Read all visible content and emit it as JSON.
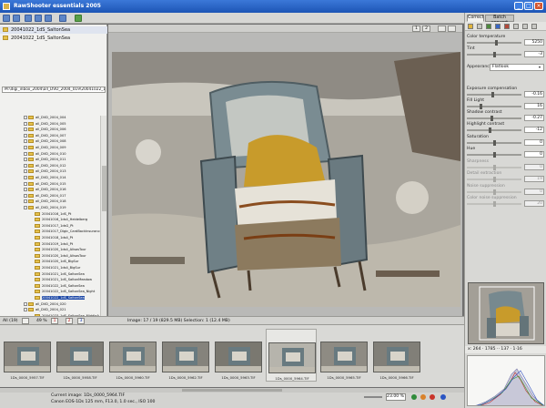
{
  "window": {
    "title": "RawShooter essentials 2005",
    "controls": {
      "minimize": "_",
      "maximize": "□",
      "close": "×"
    }
  },
  "left_panel": {
    "folders": [
      {
        "label": "20041022_1dS_SaltonSea",
        "selected": true
      },
      {
        "label": "20041022_1dS_SaltonSea",
        "selected": false
      }
    ],
    "path": "M:\\digi_inbox_2004\\all_DVD_2004_019\\20041022_1dS",
    "tree": [
      {
        "label": "all_DVD_2004_004",
        "level": 1
      },
      {
        "label": "all_DVD_2004_005",
        "level": 1
      },
      {
        "label": "all_DVD_2004_006",
        "level": 1
      },
      {
        "label": "all_DVD_2004_007",
        "level": 1
      },
      {
        "label": "all_DVD_2004_008",
        "level": 1
      },
      {
        "label": "all_DVD_2004_009",
        "level": 1
      },
      {
        "label": "all_DVD_2004_010",
        "level": 1
      },
      {
        "label": "all_DVD_2004_011",
        "level": 1
      },
      {
        "label": "all_DVD_2004_012",
        "level": 1
      },
      {
        "label": "all_DVD_2004_013",
        "level": 1
      },
      {
        "label": "all_DVD_2004_014",
        "level": 1
      },
      {
        "label": "all_DVD_2004_015",
        "level": 1
      },
      {
        "label": "all_DVD_2004_016",
        "level": 1
      },
      {
        "label": "all_DVD_2004_017",
        "level": 1
      },
      {
        "label": "all_DVD_2004_018",
        "level": 1
      },
      {
        "label": "all_DVD_2004_019",
        "level": 1
      },
      {
        "label": "20041016_1dS_Pt",
        "level": 2
      },
      {
        "label": "20041016_1ds4_Heidelberg",
        "level": 2
      },
      {
        "label": "20041017_1dsG_Pt",
        "level": 2
      },
      {
        "label": "20041017_Digic_CardBackInsurance",
        "level": 2
      },
      {
        "label": "20041018_1ds4_Pt",
        "level": 2
      },
      {
        "label": "20041019_1ds4_Pt",
        "level": 2
      },
      {
        "label": "20041020_1ds4_AlisosTour",
        "level": 2
      },
      {
        "label": "20041020_1ds4_AlisosTour",
        "level": 2
      },
      {
        "label": "20041020_1dS_BigSur",
        "level": 2
      },
      {
        "label": "20041021_1ds4_BigSur",
        "level": 2
      },
      {
        "label": "20041021_1dS_SaltonSea",
        "level": 2
      },
      {
        "label": "20041021_1dS_SaltonMeadow",
        "level": 2
      },
      {
        "label": "20041022_1dS_SaltonSea",
        "level": 2
      },
      {
        "label": "20041022_1dS_SaltonSea_Night",
        "level": 2
      },
      {
        "label": "20041022_1dS_SaltonSea",
        "level": 2,
        "selected": true
      },
      {
        "label": "all_DVD_2004_020",
        "level": 1
      },
      {
        "label": "all_DVD_2004_021",
        "level": 1
      },
      {
        "label": "20041023_1dS_SaltonSea_MiddleA",
        "level": 2
      }
    ]
  },
  "viewer": {
    "buttons": [
      "1",
      "2"
    ]
  },
  "statusbar": {
    "filter_all": "All (19)",
    "zoom": "49 %",
    "image_info": "Image: 17 / 19 (829.5 MB) Selection: 1 (12.4 MB)",
    "badges": [
      "1",
      "2",
      "3"
    ]
  },
  "filmstrip": {
    "thumbs": [
      {
        "name": "1Ds_0000_5957.TIF",
        "current": false
      },
      {
        "name": "1Ds_0000_5958.TIF",
        "current": false
      },
      {
        "name": "1Ds_0000_5960.TIF",
        "current": false
      },
      {
        "name": "1Ds_0000_5962.TIF",
        "current": false
      },
      {
        "name": "1Ds_0000_5963.TIF",
        "current": false
      },
      {
        "name": "1Ds_0000_5964.TIF",
        "current": true
      },
      {
        "name": "1Ds_0000_5965.TIF",
        "current": false
      },
      {
        "name": "1Ds_0000_5966.TIF",
        "current": false
      }
    ]
  },
  "bottombar": {
    "current_image": "Current image: 1Ds_0000_5964.TIF",
    "camera": "Canon EOS-1Ds  125 mm, F13.0, 1.0 sec., ISO 100",
    "zoom_value": "23.00 %"
  },
  "right_panel": {
    "tabs": [
      "Correct",
      "Batch convert"
    ],
    "controls": [
      {
        "label": "Color temperature",
        "value": "5250",
        "knob": 0.55,
        "dim": false
      },
      {
        "label": "Tint",
        "value": "-3",
        "knob": 0.5,
        "dim": false
      },
      {
        "label": "Exposure compensation",
        "value": "-0.16",
        "knob": 0.48,
        "dim": false
      },
      {
        "label": "Fill Light",
        "value": "16",
        "knob": 0.25,
        "dim": false
      },
      {
        "label": "Shadow contrast",
        "value": "-0.27",
        "knob": 0.45,
        "dim": false
      },
      {
        "label": "Highlight contrast",
        "value": "-12",
        "knob": 0.42,
        "dim": false
      },
      {
        "label": "Saturation",
        "value": "0",
        "knob": 0.5,
        "dim": false
      },
      {
        "label": "Hue",
        "value": "0",
        "knob": 0.5,
        "dim": false
      },
      {
        "label": "Sharpness",
        "value": "0",
        "knob": 0.5,
        "dim": true
      },
      {
        "label": "Detail extraction",
        "value": "19",
        "knob": 0.5,
        "dim": true
      },
      {
        "label": "Noise suppression",
        "value": "0",
        "knob": 0.5,
        "dim": true
      },
      {
        "label": "Color noise suppression",
        "value": "20",
        "knob": 0.5,
        "dim": true
      }
    ],
    "appearance": {
      "label": "Appearance:",
      "value": "Flatlook"
    },
    "coords": "x: 264 · 1785 ·· 137 · 1·16",
    "accent": "#1d48a6"
  }
}
